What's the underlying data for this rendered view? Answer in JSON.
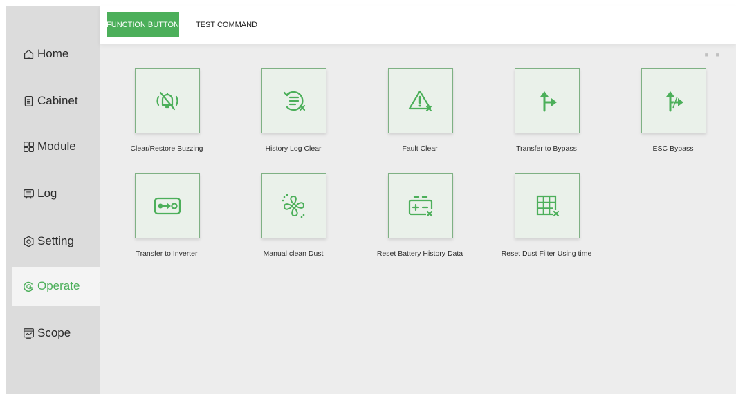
{
  "tabs": {
    "function_button": "FUNCTION BUTTON",
    "test_command": "TEST COMMAND"
  },
  "nav": [
    "Home",
    "Cabinet",
    "Module",
    "Log",
    "Setting",
    "Operate",
    "Scope"
  ],
  "functions": [
    "Clear/Restore Buzzing",
    "History Log Clear",
    "Fault Clear",
    "Transfer to Bypass",
    "ESC Bypass",
    "Transfer to Inverter",
    "Manual clean Dust",
    "Reset Battery History Data",
    "Reset Dust Filter Using time"
  ],
  "pager": "■ ■",
  "colors": {
    "accent": "#4caf5a",
    "sidebar": "#dcdcdc",
    "content": "#ededed"
  },
  "icons": [
    "home-icon",
    "cabinet-icon",
    "module-icon",
    "log-icon",
    "setting-icon",
    "operate-icon",
    "scope-icon"
  ]
}
